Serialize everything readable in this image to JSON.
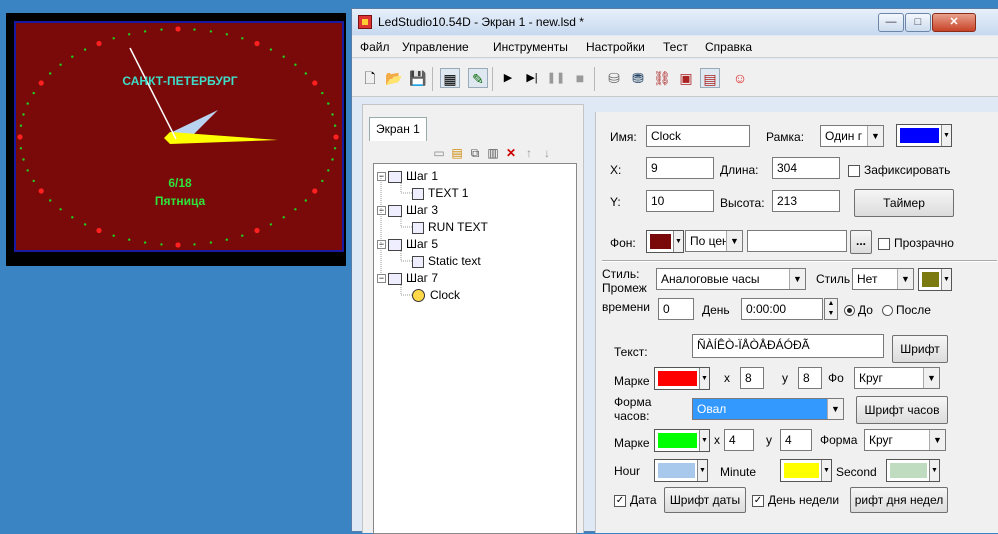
{
  "preview": {
    "city": "САНКТ-ПЕТЕРБУРГ",
    "date": "6/18",
    "weekday": "Пятница",
    "colors": {
      "background": "#7a0a0a",
      "border": "#1a1aa0",
      "text": "#3fdcc8",
      "date_text": "#2ee23b",
      "hour_hand": "#b8d4f0",
      "minute_hand": "#ffff00",
      "second_hand": "#ffffff",
      "dots": "#1fd21f",
      "markers": "#ff2020"
    }
  },
  "window": {
    "title": "LedStudio10.54D - Экран 1 - new.lsd *",
    "controls": {
      "minimize": "—",
      "maximize": "□",
      "close": "✕"
    }
  },
  "menu": [
    "Файл",
    "Управление",
    "Инструменты",
    "Настройки",
    "Тест",
    "Справка"
  ],
  "toolbar_icons": [
    "new-file-icon",
    "open-folder-icon",
    "save-icon",
    "grid-icon",
    "edit-icon",
    "play-icon",
    "step-play-icon",
    "pause-icon",
    "stop-icon",
    "send-icon",
    "receive-icon",
    "network-icon",
    "program-icon",
    "card-icon",
    "smiley-icon"
  ],
  "left": {
    "tab": "Экран 1",
    "tree": [
      {
        "label": "Шаг 1",
        "level": 0
      },
      {
        "label": "TEXT 1",
        "level": 1
      },
      {
        "label": "Шаг 3",
        "level": 0
      },
      {
        "label": "RUN TEXT",
        "level": 1
      },
      {
        "label": "Шаг 5",
        "level": 0
      },
      {
        "label": "Static text",
        "level": 1
      },
      {
        "label": "Шаг 7",
        "level": 0
      },
      {
        "label": "Clock",
        "level": 1
      }
    ]
  },
  "props": {
    "name_label": "Имя:",
    "name_value": "Clock",
    "frame_label": "Рамка:",
    "frame_value": "Один г",
    "frame_color": "#0000ff",
    "x_label": "X:",
    "x_value": "9",
    "length_label": "Длина:",
    "length_value": "304",
    "lock_label": "Зафиксировать",
    "y_label": "Y:",
    "y_value": "10",
    "height_label": "Высота:",
    "height_value": "213",
    "timer_button": "Таймер",
    "bg_label": "Фон:",
    "bg_color": "#7a0a0a",
    "bg_mode": "По цен",
    "bg_more": "...",
    "transparent_label": "Прозрачно",
    "style_label": "Стиль:",
    "style_value": "Аналоговые часы",
    "style2_label": "Стиль",
    "style2_value": "Нет",
    "style2_color": "#7a7a10",
    "interval_label_1": "Промеж",
    "interval_label_2": "времени",
    "interval_value": "0",
    "day_label": "День",
    "time_value": "0:00:00",
    "before_label": "До",
    "after_label": "После",
    "text_label": "Текст:",
    "text_value": "ÑÀÍÊÒ-ÏÅÒÅÐÁÓÐÃ",
    "font_button": "Шрифт",
    "marker1_label": "Марке",
    "marker1_color": "#ff0000",
    "x_small": "x",
    "marker1_x": "8",
    "y_small": "y",
    "marker1_y": "8",
    "shape1_label": "Фо",
    "shape1_value": "Круг",
    "clock_shape_label_1": "Форма",
    "clock_shape_label_2": "часов:",
    "clock_shape_value": "Овал",
    "clock_font_button": "Шрифт часов",
    "marker2_label": "Марке",
    "marker2_color": "#00ff00",
    "marker2_x": "4",
    "marker2_y": "4",
    "shape2_label": "Форма",
    "shape2_value": "Круг",
    "hour_label": "Hour",
    "hour_color": "#a8c8ec",
    "minute_label": "Minute",
    "minute_color": "#ffff00",
    "second_label": "Second",
    "second_color": "#c0dcc0",
    "date_label": "Дата",
    "date_font_button": "Шрифт даты",
    "weekday_label": "День недели",
    "weekday_font_button": "рифт дня недел"
  }
}
